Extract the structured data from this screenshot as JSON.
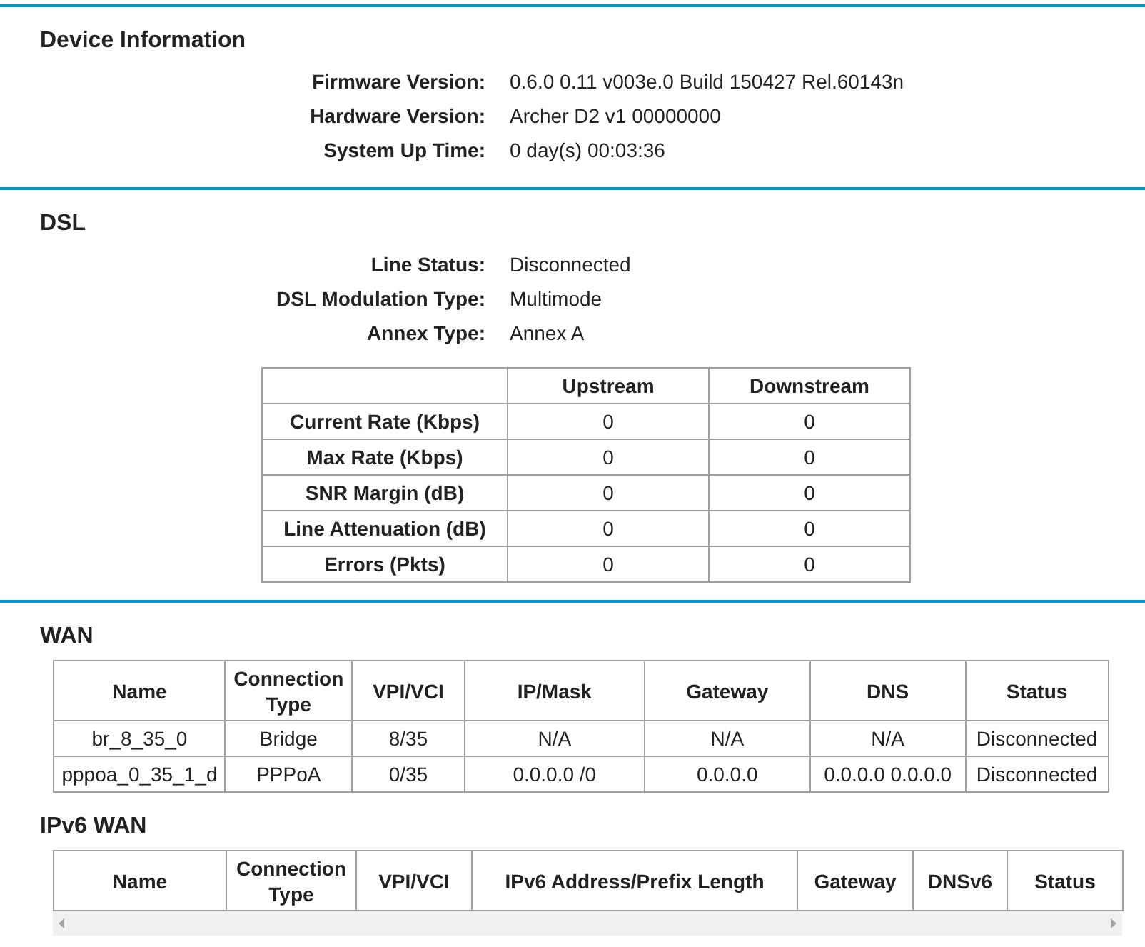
{
  "device_information": {
    "title": "Device Information",
    "fields": [
      {
        "label": "Firmware Version:",
        "value": "0.6.0 0.11 v003e.0 Build 150427 Rel.60143n"
      },
      {
        "label": "Hardware Version:",
        "value": "Archer D2 v1 00000000"
      },
      {
        "label": "System Up Time:",
        "value": "0 day(s) 00:03:36"
      }
    ]
  },
  "dsl": {
    "title": "DSL",
    "fields": [
      {
        "label": "Line Status:",
        "value": "Disconnected"
      },
      {
        "label": "DSL Modulation Type:",
        "value": "Multimode"
      },
      {
        "label": "Annex Type:",
        "value": "Annex A"
      }
    ],
    "table": {
      "columns": [
        "Upstream",
        "Downstream"
      ],
      "rows": [
        {
          "label": "Current Rate (Kbps)",
          "cells": [
            "0",
            "0"
          ]
        },
        {
          "label": "Max Rate (Kbps)",
          "cells": [
            "0",
            "0"
          ]
        },
        {
          "label": "SNR Margin (dB)",
          "cells": [
            "0",
            "0"
          ]
        },
        {
          "label": "Line Attenuation (dB)",
          "cells": [
            "0",
            "0"
          ]
        },
        {
          "label": "Errors (Pkts)",
          "cells": [
            "0",
            "0"
          ]
        }
      ]
    }
  },
  "wan": {
    "title": "WAN",
    "columns": [
      "Name",
      "Connection Type",
      "VPI/VCI",
      "IP/Mask",
      "Gateway",
      "DNS",
      "Status"
    ],
    "rows": [
      [
        "br_8_35_0",
        "Bridge",
        "8/35",
        "N/A",
        "N/A",
        "N/A",
        "Disconnected"
      ],
      [
        "pppoa_0_35_1_d",
        "PPPoA",
        "0/35",
        "0.0.0.0 /0",
        "0.0.0.0",
        "0.0.0.0 0.0.0.0",
        "Disconnected"
      ]
    ]
  },
  "ipv6_wan": {
    "title": "IPv6 WAN",
    "columns": [
      "Name",
      "Connection Type",
      "VPI/VCI",
      "IPv6 Address/Prefix Length",
      "Gateway",
      "DNSv6",
      "Status"
    ]
  }
}
